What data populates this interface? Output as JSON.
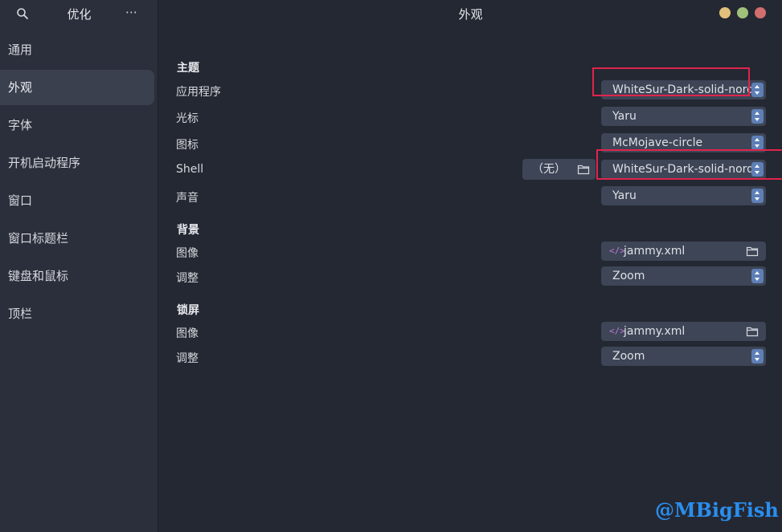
{
  "sidebar": {
    "title": "优化",
    "menu_glyph": "⋯",
    "items": [
      {
        "label": "通用",
        "active": false
      },
      {
        "label": "外观",
        "active": true
      },
      {
        "label": "字体",
        "active": false
      },
      {
        "label": "开机启动程序",
        "active": false
      },
      {
        "label": "窗口",
        "active": false
      },
      {
        "label": "窗口标题栏",
        "active": false
      },
      {
        "label": "键盘和鼠标",
        "active": false
      },
      {
        "label": "顶栏",
        "active": false
      }
    ]
  },
  "header": {
    "title": "外观"
  },
  "themes": {
    "heading": "主题",
    "application": {
      "label": "应用程序",
      "value": "WhiteSur-Dark-solid-nord"
    },
    "cursor": {
      "label": "光标",
      "value": "Yaru"
    },
    "icons": {
      "label": "图标",
      "value": "McMojave-circle"
    },
    "shell": {
      "label": "Shell",
      "none_label": "（无）",
      "value": "WhiteSur-Dark-solid-nord"
    },
    "sound": {
      "label": "声音",
      "value": "Yaru"
    }
  },
  "background": {
    "heading": "背景",
    "image": {
      "label": "图像",
      "icon": "</>",
      "value": "jammy.xml"
    },
    "adjust": {
      "label": "调整",
      "value": "Zoom"
    }
  },
  "lockscreen": {
    "heading": "锁屏",
    "image": {
      "label": "图像",
      "icon": "</>",
      "value": "jammy.xml"
    },
    "adjust": {
      "label": "调整",
      "value": "Zoom"
    }
  },
  "watermark": "@MBigFish",
  "colors": {
    "accent": "#5e7fb6",
    "highlight": "#e0244c",
    "window_close": "#d16e6e",
    "window_max": "#9fc17a",
    "window_min": "#e3c07b"
  }
}
